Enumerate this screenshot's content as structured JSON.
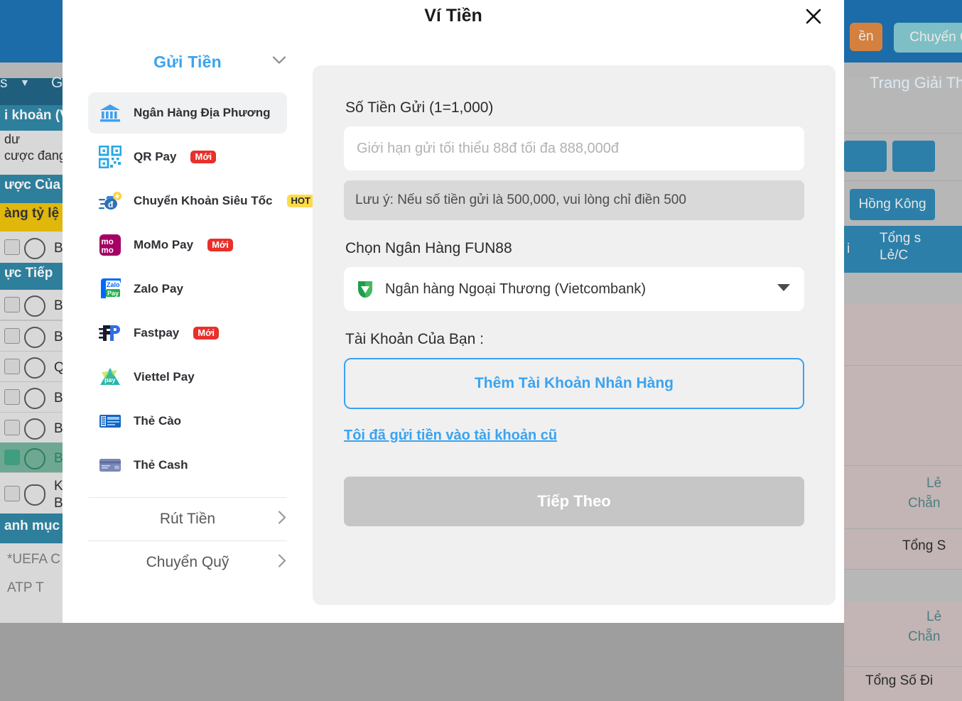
{
  "modal": {
    "title": "Ví Tiền",
    "close_icon": "close-icon"
  },
  "sidebar": {
    "section_title": "Gửi Tiền",
    "section_chevron_icon": "chevron-down-icon",
    "methods": [
      {
        "label": "Ngân Hàng Địa Phương",
        "icon": "bank-icon",
        "badge": "",
        "active": true
      },
      {
        "label": "QR Pay",
        "icon": "qr-pay-icon",
        "badge": "Mới",
        "badge_color": "#e8302a",
        "active": false
      },
      {
        "label": "Chuyển Khoản Siêu Tốc",
        "icon": "fast-transfer-icon",
        "badge": "HOT",
        "badge_color": "#fcdb4d",
        "active": false
      },
      {
        "label": "MoMo Pay",
        "icon": "momo-icon",
        "badge": "Mới",
        "badge_color": "#e8302a",
        "active": false
      },
      {
        "label": "Zalo Pay",
        "icon": "zalopay-icon",
        "badge": "",
        "active": false
      },
      {
        "label": "Fastpay",
        "icon": "fastpay-icon",
        "badge": "Mới",
        "badge_color": "#e8302a",
        "active": false
      },
      {
        "label": "Viettel Pay",
        "icon": "viettelpay-icon",
        "badge": "",
        "active": false
      },
      {
        "label": "Thẻ Cào",
        "icon": "scratch-card-icon",
        "badge": "",
        "active": false
      },
      {
        "label": "Thẻ Cash",
        "icon": "cash-card-icon",
        "badge": "",
        "active": false
      }
    ],
    "withdraw_label": "Rút Tiền",
    "transfer_label": "Chuyển Quỹ",
    "row_chevron_icon": "chevron-right-icon"
  },
  "form": {
    "amount_label": "Số Tiền Gửi (1=1,000)",
    "amount_placeholder": "Giới hạn gửi tối thiểu 88đ tối đa 888,000đ",
    "amount_value": "",
    "note_text": "Lưu ý: Nếu số tiền gửi là 500,000, vui lòng chỉ điền 500",
    "bank_label": "Chọn Ngân Hàng FUN88",
    "bank_selected": "Ngân hàng Ngoại Thương (Vietcombank)",
    "bank_icon": "vietcombank-shield-icon",
    "bank_caret_icon": "caret-down-icon",
    "account_label": "Tài Khoản Của Bạn :",
    "add_account_label": "Thêm Tài Khoản Nhân Hàng",
    "old_account_link": "Tôi đã gửi tiền vào tài khoản cũ",
    "next_label": "Tiếp Theo",
    "accent_color": "#3aa3ef",
    "next_disabled_color": "#c6c6c6"
  },
  "background": {
    "topnav": {
      "caret_icon": "chevron-down-icon",
      "item1": "s",
      "item2": "G"
    },
    "right": {
      "orange_button": "ền",
      "teal_button": "Chuyển Q",
      "promo_link": "Trang Giải Thư",
      "note_icon": "note-icon",
      "history-icon": "bet-history-icon",
      "region_button": "Hồng Kông",
      "col_header": "Tổng s\nLẻ/C",
      "rows": [
        "Tổng Số Đi",
        "Lẻ",
        "Chẵn",
        "Tổng S",
        "Lẻ",
        "Chẵn",
        "Tổng Số Đi"
      ]
    },
    "left": {
      "account_line": "i khoản (V",
      "balance_line1": "dư",
      "balance_line2": "cược đang",
      "my_bets_header": "ược Của",
      "promo_bar": "àng tỷ lệ c",
      "live_header": "ực Tiếp",
      "sports": [
        "Bón",
        "Bón",
        "Bón",
        "Quả",
        "Bi M",
        "Bón",
        "Bón",
        "Khú",
        "Băn"
      ],
      "category_header": "anh mục t",
      "event1": "*UEFA C",
      "event2": "ATP T"
    }
  }
}
